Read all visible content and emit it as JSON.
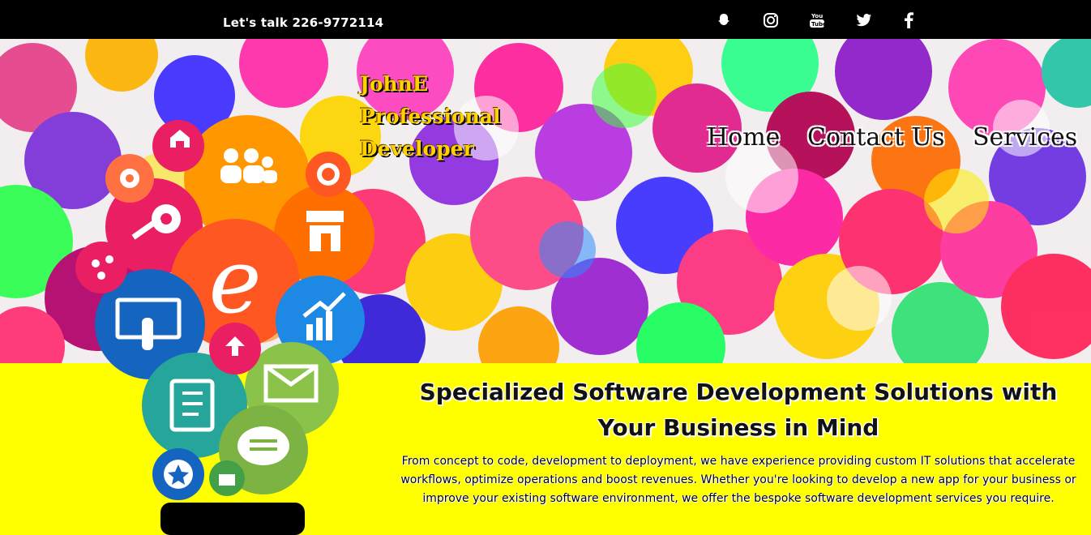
{
  "topbar": {
    "phone_text": "Let's talk 226-9772114",
    "social": [
      {
        "icon": "snapchat-icon"
      },
      {
        "icon": "instagram-icon"
      },
      {
        "icon": "youtube-icon",
        "text": "You Tube"
      },
      {
        "icon": "twitter-icon"
      },
      {
        "icon": "facebook-icon"
      }
    ]
  },
  "brand": {
    "line1": "JohnE",
    "line2": "Professional",
    "line3": "Developer"
  },
  "nav": {
    "home": "Home",
    "contact": "Contact Us",
    "services": "Services"
  },
  "hero_art": {
    "center_letter": "e"
  },
  "section": {
    "headline": "Specialized Software Development Solutions with Your Business in Mind",
    "body": "From concept to code, development to deployment, we have experience providing custom IT solutions that accelerate workflows, optimize operations and boost revenues. Whether you're looking to develop a new app for your business or improve your existing software environment, we offer the bespoke software development services you require."
  },
  "colors": {
    "topbar_bg": "#000000",
    "brand": "#ffd200",
    "section_bg": "#ffff00"
  }
}
